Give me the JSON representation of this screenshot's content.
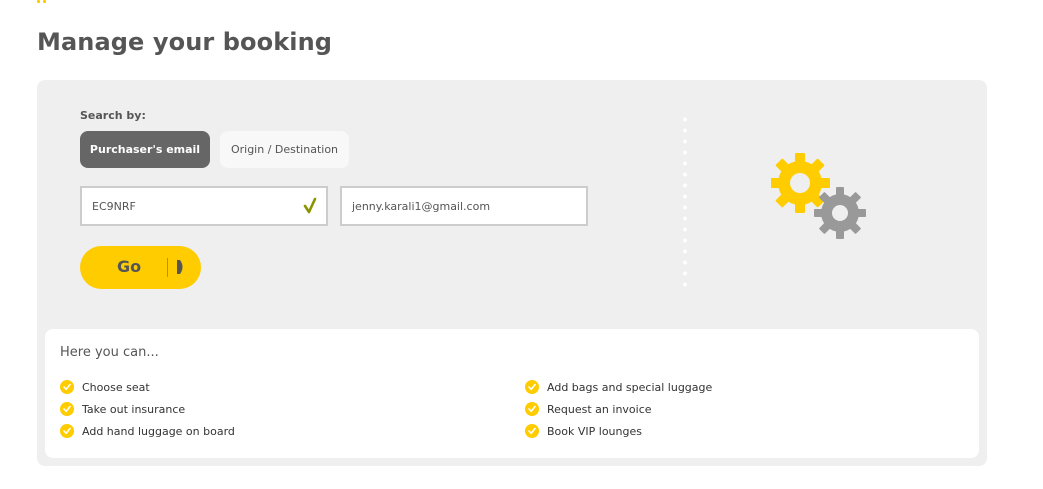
{
  "page": {
    "title": "Manage your booking"
  },
  "search": {
    "label": "Search by:",
    "tabs": [
      {
        "label": "Purchaser's email",
        "active": true
      },
      {
        "label": "Origin / Destination",
        "active": false
      }
    ],
    "booking_code": {
      "value": "EC9NRF",
      "valid": true
    },
    "email": {
      "value": "jenny.karali1@gmail.com"
    },
    "go_label": "Go"
  },
  "info": {
    "heading": "Here you can...",
    "left_items": [
      "Choose seat",
      "Take out insurance",
      "Add hand luggage on board"
    ],
    "right_items": [
      "Add bags and special luggage",
      "Request an invoice",
      "Book VIP lounges"
    ]
  },
  "colors": {
    "accent": "#ffcc00",
    "active_tab": "#666666",
    "panel_bg": "#efefef",
    "gear_secondary": "#999999",
    "valid_check": "#8a9400"
  },
  "icons": {
    "illustration": "gears-icon",
    "field_status": "checkmark-icon",
    "go_arrow": "arrow-right-icon",
    "list_bullet": "check-circle-icon"
  }
}
